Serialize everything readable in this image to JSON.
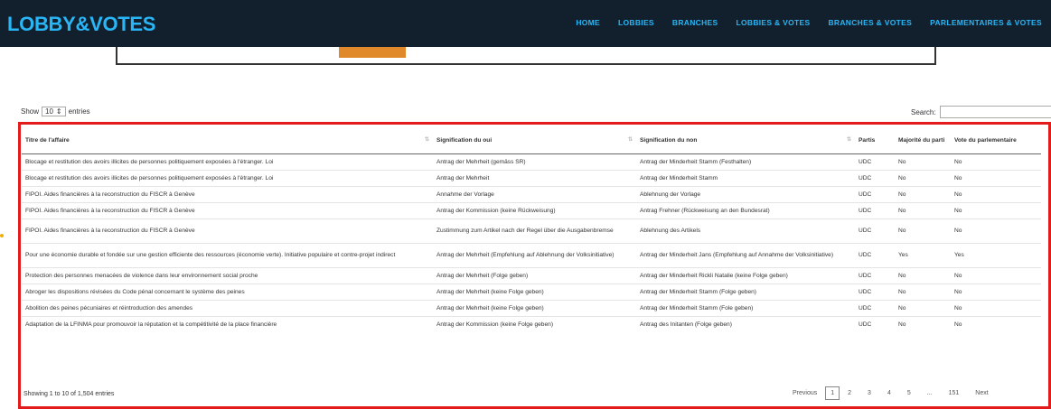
{
  "header": {
    "brand": "LOBBY&VOTES",
    "nav": [
      "HOME",
      "LOBBIES",
      "BRANCHES",
      "LOBBIES & VOTES",
      "BRANCHES & VOTES",
      "PARLEMENTAIRES & VOTES"
    ]
  },
  "controls": {
    "show_label": "Show",
    "show_value": "10",
    "entries_label": "entries",
    "search_label": "Search:",
    "search_value": ""
  },
  "table": {
    "columns": [
      "Titre de l'affaire",
      "Signification du oui",
      "Signification du non",
      "Partis",
      "Majorité du parti",
      "Vote du parlementaire"
    ],
    "rows": [
      [
        "Blocage et restitution des avoirs illicites de personnes politiquement exposées à l'étranger. Loi",
        "Antrag der Mehrheit (gemäss SR)",
        "Antrag der Minderheit Stamm (Festhalten)",
        "UDC",
        "No",
        "No"
      ],
      [
        "Blocage et restitution des avoirs illicites de personnes politiquement exposées à l'étranger. Loi",
        "Antrag der Mehrheit",
        "Antrag der Minderheit Stamm",
        "UDC",
        "No",
        "No"
      ],
      [
        "FIPOI. Aides financières à la reconstruction du FISCR à Genève",
        "Annahme der Vorlage",
        "Ablehnung der Vorlage",
        "UDC",
        "No",
        "No"
      ],
      [
        "FIPOI. Aides financières à la reconstruction du FISCR à Genève",
        "Antrag der Kommission (keine Rückweisung)",
        "Antrag Frehner (Rückweisung an den Bundesrat)",
        "UDC",
        "No",
        "No"
      ],
      [
        "FIPOI. Aides financières à la reconstruction du FISCR à Genève",
        "Zustimmung zum Artikel nach der Regel über die Ausgabenbremse",
        "Ablehnung des Artikels",
        "UDC",
        "No",
        "No"
      ],
      [
        "Pour une économie durable et fondée sur une gestion efficiente des ressources (économie verte). Initiative populaire et contre-projet indirect",
        "Antrag der Mehrheit (Empfehlung auf Ablehnung der Volksinitiative)",
        "Antrag der Minderheit Jans (Empfehlung auf Annahme der Volksinitiative)",
        "UDC",
        "Yes",
        "Yes"
      ],
      [
        "Protection des personnes menacées de violence dans leur environnement social proche",
        "Antrag der Mehrheit (Folge geben)",
        "Antrag der Minderheit Rickli Natalie (keine Folge geben)",
        "UDC",
        "No",
        "No"
      ],
      [
        "Abroger les dispositions révisées du Code pénal concernant le système des peines",
        "Antrag der Mehrheit (keine Folge geben)",
        "Antrag der Minderheit Stamm (Folge geben)",
        "UDC",
        "No",
        "No"
      ],
      [
        "Abolition des peines pécuniaires et réintroduction des amendes",
        "Antrag der Mehrheit (keine Folge geben)",
        "Antrag der Minderheit Stamm (Fole geben)",
        "UDC",
        "No",
        "No"
      ],
      [
        "Adaptation de la LFINMA pour promouvoir la réputation et la compétitivité de la place financière",
        "Antrag der Kommission (keine Folge geben)",
        "Antrag des Initanten (Folge geben)",
        "UDC",
        "No",
        "No"
      ]
    ]
  },
  "footer": {
    "info": "Showing 1 to 10 of 1,504 entries",
    "pagination": [
      "Previous",
      "1",
      "2",
      "3",
      "4",
      "5",
      "...",
      "151",
      "Next"
    ],
    "current_page": "1"
  },
  "colors": {
    "nav_bg": "#12202e",
    "accent": "#29b6f6",
    "highlight": "#e31b1b",
    "chart_bar": "#e0892a"
  }
}
